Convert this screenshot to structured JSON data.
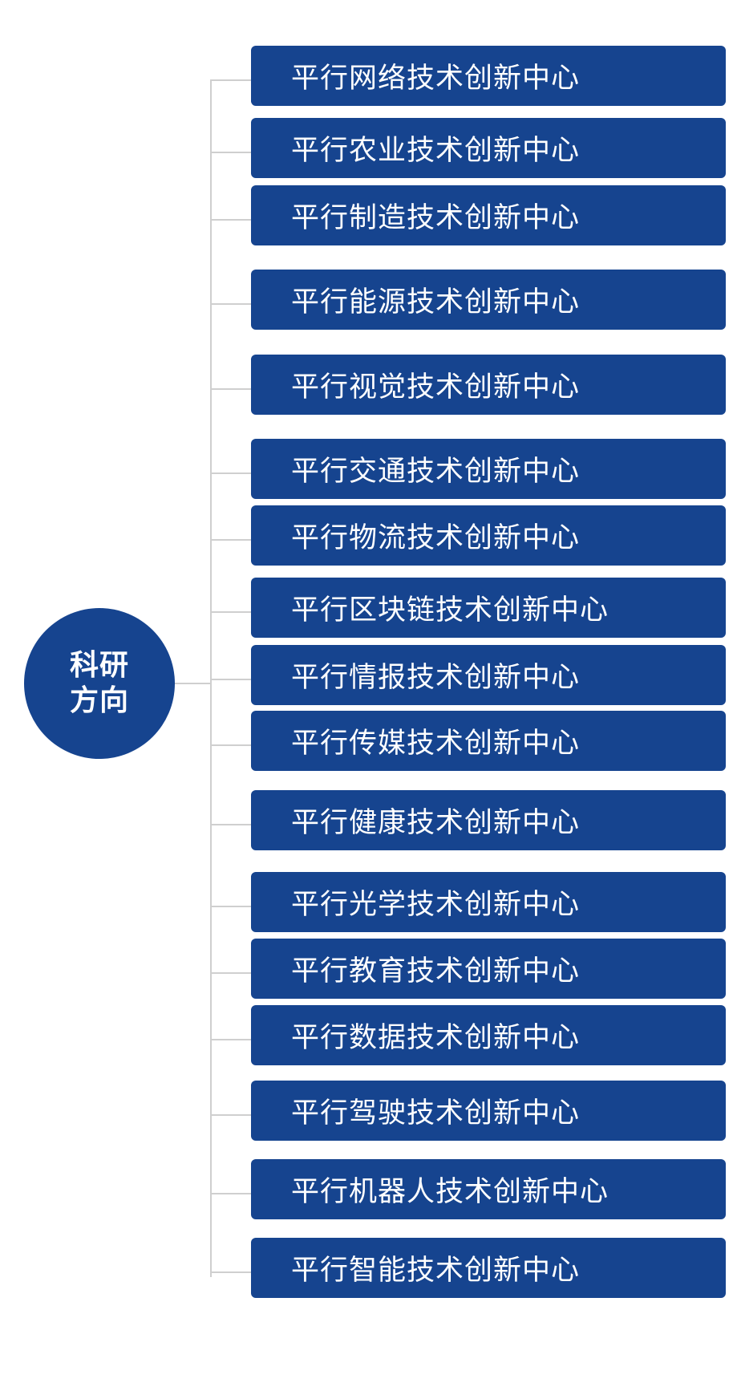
{
  "colors": {
    "node_fill": "#16448f",
    "text": "#ffffff",
    "connector": "#cfcfcf",
    "background": "#ffffff"
  },
  "hub": {
    "label": "科研方向"
  },
  "centers": [
    "平行网络技术创新中心",
    "平行农业技术创新中心",
    "平行制造技术创新中心",
    "平行能源技术创新中心",
    "平行视觉技术创新中心",
    "平行交通技术创新中心",
    "平行物流技术创新中心",
    "平行区块链技术创新中心",
    "平行情报技术创新中心",
    "平行传媒技术创新中心",
    "平行健康技术创新中心",
    "平行光学技术创新中心",
    "平行教育技术创新中心",
    "平行数据技术创新中心",
    "平行驾驶技术创新中心",
    "平行机器人技术创新中心",
    "平行智能技术创新中心"
  ]
}
